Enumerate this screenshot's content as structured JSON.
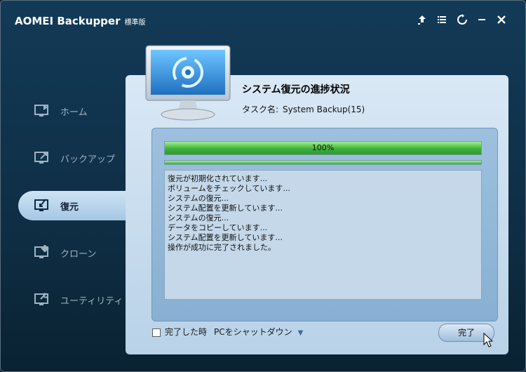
{
  "app": {
    "title": "AOMEI Backupper",
    "edition": "標準版"
  },
  "window_controls": [
    {
      "name": "upgrade-icon"
    },
    {
      "name": "menu-icon"
    },
    {
      "name": "refresh-icon"
    },
    {
      "name": "minimize-icon"
    },
    {
      "name": "close-icon"
    }
  ],
  "sidebar": {
    "items": [
      {
        "label": "ホーム",
        "icon": "home-monitor-icon",
        "active": false
      },
      {
        "label": "バックアップ",
        "icon": "backup-icon",
        "active": false
      },
      {
        "label": "復元",
        "icon": "restore-icon",
        "active": true
      },
      {
        "label": "クローン",
        "icon": "clone-icon",
        "active": false
      },
      {
        "label": "ユーティリティ",
        "icon": "utilities-icon",
        "active": false
      }
    ]
  },
  "task": {
    "title": "システム復元の進捗状況",
    "name_label": "タスク名:",
    "name_value": "System Backup(15)"
  },
  "progress": {
    "text": "100%",
    "value": 1.0,
    "secondary_value": 1.0
  },
  "log": {
    "lines": [
      "復元が初期化されています...",
      "ボリュームをチェックしています...",
      "システムの復元...",
      "システム配置を更新しています...",
      "システムの復元...",
      "データをコピーしています...",
      "システム配置を更新しています...",
      "操作が成功に完了されました。"
    ]
  },
  "shutdown": {
    "checkbox_label": "完了した時",
    "option": "PCをシャットダウン",
    "checked": false
  },
  "done_button": {
    "label": "完了"
  },
  "colors": {
    "accent": "#3fb13a",
    "panel": "#c8dcee",
    "background": "#0f2e45"
  }
}
